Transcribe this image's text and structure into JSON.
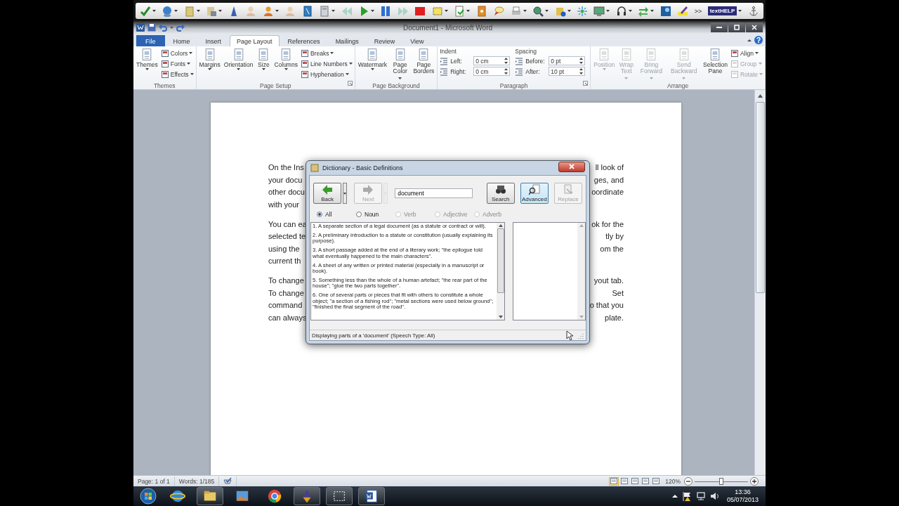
{
  "toolbar": {
    "buttons": [
      {
        "dropdown": true,
        "disabled": false
      },
      {
        "dropdown": true,
        "disabled": false
      },
      {
        "dropdown": true,
        "disabled": false
      },
      {
        "dropdown": true,
        "disabled": false
      },
      {
        "dropdown": false,
        "disabled": false
      },
      {
        "dropdown": false,
        "disabled": true
      },
      {
        "dropdown": true,
        "disabled": false
      },
      {
        "dropdown": false,
        "disabled": true
      },
      {
        "dropdown": false,
        "disabled": false
      },
      {
        "dropdown": true,
        "disabled": false
      },
      {
        "dropdown": false,
        "disabled": true
      },
      {
        "dropdown": true,
        "disabled": false
      },
      {
        "dropdown": false,
        "disabled": false
      },
      {
        "dropdown": false,
        "disabled": true
      },
      {
        "dropdown": false,
        "disabled": false
      },
      {
        "dropdown": true,
        "disabled": false
      },
      {
        "dropdown": true,
        "disabled": false
      },
      {
        "dropdown": false,
        "disabled": false
      },
      {
        "dropdown": false,
        "disabled": false
      },
      {
        "dropdown": true,
        "disabled": false
      },
      {
        "dropdown": true,
        "disabled": false
      },
      {
        "dropdown": true,
        "disabled": false
      },
      {
        "dropdown": false,
        "disabled": false
      },
      {
        "dropdown": true,
        "disabled": false
      },
      {
        "dropdown": true,
        "disabled": false
      },
      {
        "dropdown": true,
        "disabled": false
      },
      {
        "dropdown": false,
        "disabled": false
      },
      {
        "dropdown": false,
        "disabled": false
      }
    ],
    "overflow": ">>",
    "brand": {
      "label": "textHELP",
      "dropdown": true
    }
  },
  "window": {
    "title": "Document1 - Microsoft Word"
  },
  "tabs": [
    {
      "label": "File",
      "kind": "file",
      "selected": false
    },
    {
      "label": "Home",
      "kind": "tab",
      "selected": false
    },
    {
      "label": "Insert",
      "kind": "tab",
      "selected": false
    },
    {
      "label": "Page Layout",
      "kind": "tab",
      "selected": true
    },
    {
      "label": "References",
      "kind": "tab",
      "selected": false
    },
    {
      "label": "Mailings",
      "kind": "tab",
      "selected": false
    },
    {
      "label": "Review",
      "kind": "tab",
      "selected": false
    },
    {
      "label": "View",
      "kind": "tab",
      "selected": false
    }
  ],
  "ribbon": [
    {
      "label": "Themes",
      "launcher": false,
      "columns": [
        {
          "kind": "large",
          "lines": [
            "Themes"
          ],
          "dropdown": true,
          "disabled": false
        },
        {
          "kind": "stack",
          "items": [
            {
              "label": "Colors",
              "dropdown": true,
              "disabled": false
            },
            {
              "label": "Fonts",
              "dropdown": true,
              "disabled": false
            },
            {
              "label": "Effects",
              "dropdown": true,
              "disabled": false
            }
          ]
        }
      ]
    },
    {
      "label": "Page Setup",
      "launcher": true,
      "columns": [
        {
          "kind": "large",
          "lines": [
            "Margins"
          ],
          "dropdown": true,
          "disabled": false
        },
        {
          "kind": "large",
          "lines": [
            "Orientation"
          ],
          "dropdown": true,
          "disabled": false
        },
        {
          "kind": "large",
          "lines": [
            "Size"
          ],
          "dropdown": true,
          "disabled": false
        },
        {
          "kind": "large",
          "lines": [
            "Columns"
          ],
          "dropdown": true,
          "disabled": false
        },
        {
          "kind": "stack",
          "items": [
            {
              "label": "Breaks",
              "dropdown": true,
              "disabled": false
            },
            {
              "label": "Line Numbers",
              "dropdown": true,
              "disabled": false
            },
            {
              "label": "Hyphenation",
              "dropdown": true,
              "disabled": false
            }
          ]
        }
      ]
    },
    {
      "label": "Page Background",
      "launcher": false,
      "columns": [
        {
          "kind": "large",
          "lines": [
            "Watermark"
          ],
          "dropdown": true,
          "disabled": false
        },
        {
          "kind": "large",
          "lines": [
            "Page",
            "Color"
          ],
          "dropdown": true,
          "disabled": false
        },
        {
          "kind": "large",
          "lines": [
            "Page",
            "Borders"
          ],
          "dropdown": false,
          "disabled": false
        }
      ]
    },
    {
      "label": "Paragraph",
      "launcher": true,
      "columns": [
        {
          "kind": "spinners",
          "heading": "Indent",
          "items": [
            {
              "label": "Left:",
              "value": "0 cm"
            },
            {
              "label": "Right:",
              "value": "0 cm"
            }
          ]
        },
        {
          "kind": "spinners",
          "heading": "Spacing",
          "items": [
            {
              "label": "Before:",
              "value": "0 pt"
            },
            {
              "label": "After:",
              "value": "10 pt"
            }
          ]
        }
      ]
    },
    {
      "label": "Arrange",
      "launcher": false,
      "columns": [
        {
          "kind": "large",
          "lines": [
            "Position"
          ],
          "dropdown": true,
          "disabled": true
        },
        {
          "kind": "large",
          "lines": [
            "Wrap",
            "Text"
          ],
          "dropdown": true,
          "disabled": true
        },
        {
          "kind": "large",
          "lines": [
            "Bring",
            "Forward"
          ],
          "dropdown": true,
          "disabled": true
        },
        {
          "kind": "large",
          "lines": [
            "Send",
            "Backward"
          ],
          "dropdown": true,
          "disabled": true
        },
        {
          "kind": "large",
          "lines": [
            "Selection",
            "Pane"
          ],
          "dropdown": false,
          "disabled": false
        },
        {
          "kind": "stack",
          "items": [
            {
              "label": "Align",
              "dropdown": true,
              "disabled": false
            },
            {
              "label": "Group",
              "dropdown": true,
              "disabled": true
            },
            {
              "label": "Rotate",
              "dropdown": true,
              "disabled": true
            }
          ]
        }
      ]
    }
  ],
  "document": {
    "paragraphs": [
      {
        "lines": [
          {
            "left": "On the Ins",
            "right": "ll look of"
          },
          {
            "left": "your docu",
            "right": "ges, and"
          },
          {
            "left": "other docu",
            "right": "oordinate"
          },
          {
            "left": "with your"
          }
        ]
      },
      {
        "lines": [
          {
            "left": "You can ea",
            "right": "ok for the"
          },
          {
            "left": "selected te",
            "right": "tly by"
          },
          {
            "left": "using the",
            "right": "om the"
          },
          {
            "left": "current th"
          }
        ]
      },
      {
        "lines": [
          {
            "left": "To change",
            "right": "yout tab."
          },
          {
            "left": "To change",
            "right": "Set"
          },
          {
            "left": "command",
            "right": "o that you"
          },
          {
            "left": "can always",
            "right": "plate."
          }
        ]
      }
    ]
  },
  "dialog": {
    "title": "Dictionary - Basic Definitions",
    "nav": [
      {
        "label": "Back",
        "kind": "back",
        "disabled": false
      },
      {
        "label": "Next",
        "kind": "next",
        "disabled": true
      }
    ],
    "query": "document",
    "actions": [
      {
        "label": "Search",
        "kind": "search",
        "disabled": false,
        "pressed": false
      },
      {
        "label": "Advanced",
        "kind": "advanced",
        "disabled": false,
        "pressed": true
      },
      {
        "label": "Replace",
        "kind": "replace",
        "disabled": true,
        "pressed": false
      }
    ],
    "speech_types": [
      {
        "label": "All",
        "selected": true,
        "disabled": false
      },
      {
        "label": "Noun",
        "selected": false,
        "disabled": false
      },
      {
        "label": "Verb",
        "selected": false,
        "disabled": true
      },
      {
        "label": "Adjective",
        "selected": false,
        "disabled": true
      },
      {
        "label": "Adverb",
        "selected": false,
        "disabled": true
      }
    ],
    "definitions": [
      "1. A separate section of a legal document (as a statute or contract or will).",
      "2. A preliminary introduction to a statute or constitution (usually explaining its purpose).",
      "3. A short passage added at the end of a literary work; \"the epilogue told what eventually happened to the main characters\".",
      "4. A sheet of any written or printed material (especially in a manuscript or book).",
      "5. Something less than the whole of a human artefact; \"the rear part of the house\"; \"glue the two parts together\".",
      "6. One of several parts or pieces that fit with others to constitute a whole object; \"a section of a fishing rod\"; \"metal sections were used below ground\"; \"finished the final segment of the road\"."
    ],
    "status": "Displaying parts of a 'document' (Speech Type: All)"
  },
  "status_bar": {
    "page": "Page: 1 of 1",
    "words": "Words: 1/185",
    "views": [
      {
        "selected": true
      },
      {
        "selected": false
      },
      {
        "selected": false
      },
      {
        "selected": false
      },
      {
        "selected": false
      }
    ],
    "zoom": {
      "reading": "120%",
      "level": 0.5
    }
  },
  "taskbar": {
    "apps": [
      {
        "open": false
      },
      {
        "open": true
      },
      {
        "open": false
      },
      {
        "open": false
      },
      {
        "open": true
      },
      {
        "open": true
      },
      {
        "open": true
      }
    ],
    "time": "13:36",
    "date": "05/07/2013"
  }
}
